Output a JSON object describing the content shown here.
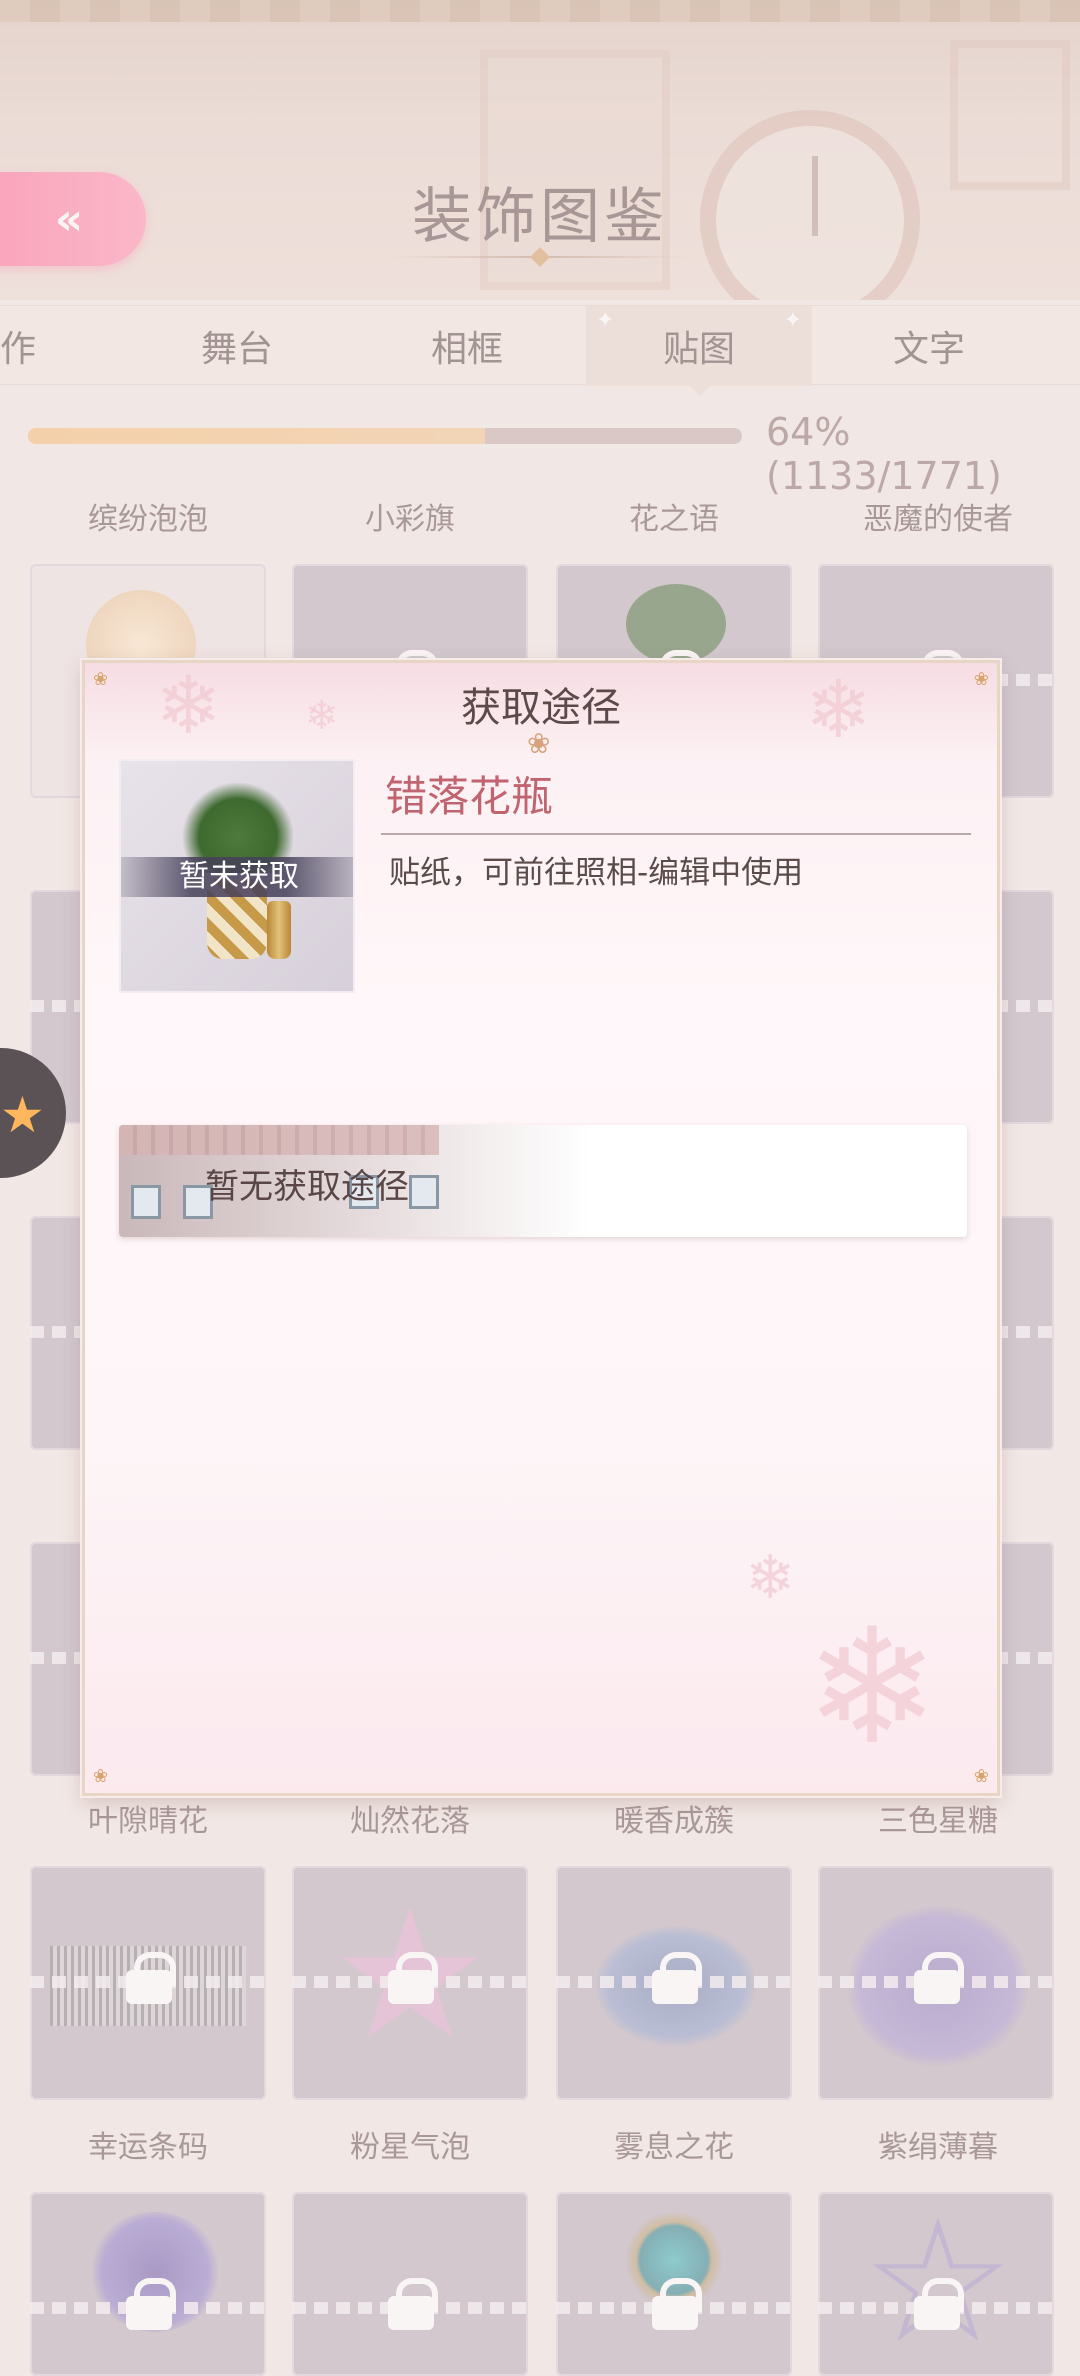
{
  "header": {
    "title": "装饰图鉴",
    "back_icon": "«"
  },
  "tabs": [
    {
      "label": "动作",
      "active": false
    },
    {
      "label": "舞台",
      "active": false
    },
    {
      "label": "相框",
      "active": false
    },
    {
      "label": "贴图",
      "active": true
    },
    {
      "label": "文字",
      "active": false
    }
  ],
  "progress": {
    "fraction": 0.64,
    "text": "64%(1133/1771)"
  },
  "grid": {
    "row1_labels": [
      "缤纷泡泡",
      "小彩旗",
      "花之语",
      "恶魔的使者"
    ],
    "row_mid_labels": [
      "叶隙晴花",
      "灿然花落",
      "暖香成簇",
      "三色星糖"
    ],
    "row_bottom_labels": [
      "幸运条码",
      "粉星气泡",
      "雾息之花",
      "紫绢薄暮"
    ]
  },
  "modal": {
    "title": "获取途径",
    "item_name": "错落花瓶",
    "thumb_status": "暂未获取",
    "description": "贴纸，可前往照相-编辑中使用",
    "acquisition_text": "暂无获取途径"
  },
  "colors": {
    "accent_pink": "#ff6a93",
    "progress_fill": "#f3bc76",
    "item_name": "#c0646f"
  }
}
